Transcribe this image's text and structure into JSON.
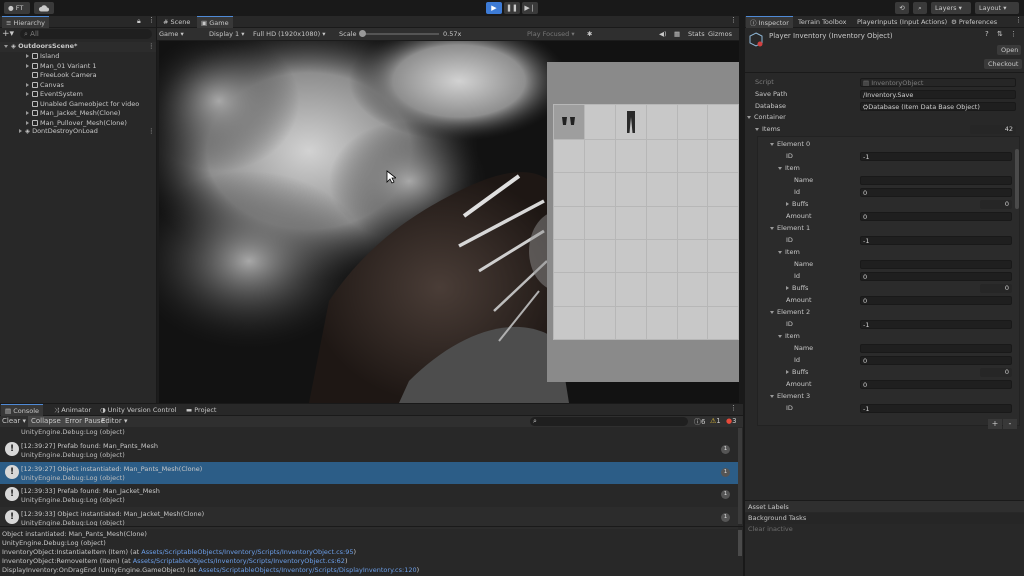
{
  "toolbar": {
    "account": "FT",
    "cloud_icon": "cloud-icon",
    "layers": "Layers",
    "layout": "Layout",
    "play_accent": "#3d7bd6"
  },
  "hierarchy": {
    "tab": "Hierarchy",
    "search_placeholder": "All",
    "scene": "OutdoorsScene*",
    "items": [
      "Island",
      "Man_01 Variant 1",
      "FreeLook Camera",
      "Canvas",
      "EventSystem",
      "Unabled Gameobject for video",
      "Man_Jacket_Mesh(Clone)",
      "Man_Pullover_Mesh(Clone)"
    ],
    "dont_destroy": "DontDestroyOnLoad"
  },
  "game_view": {
    "tabs": [
      "Scene",
      "Game"
    ],
    "mode": "Game",
    "display": "Display 1",
    "resolution": "Full HD (1920x1080)",
    "scale_label": "Scale",
    "scale_value": "0.57x",
    "play_focused": "Play Focused",
    "stats": "Stats",
    "gizmos": "Gizmos"
  },
  "inspector": {
    "tabs": [
      "Inspector",
      "Terrain Toolbox",
      "PlayerInputs (Input Actions)",
      "Preferences"
    ],
    "title": "Player Inventory (Inventory Object)",
    "open": "Open",
    "checkout": "Checkout",
    "script_label": "Script",
    "script_value": "InventoryObject",
    "save_path_label": "Save Path",
    "save_path_value": "/Inventory.Save",
    "database_label": "Database",
    "database_value": "Database (Item Data Base Object)",
    "container_label": "Container",
    "items_label": "Items",
    "items_count": "42",
    "elements": [
      {
        "name": "Element 0",
        "id": "-1",
        "item_id": "0",
        "buffs": "0",
        "amount": "0"
      },
      {
        "name": "Element 1",
        "id": "-1",
        "item_id": "0",
        "buffs": "0",
        "amount": "0"
      },
      {
        "name": "Element 2",
        "id": "-1",
        "item_id": "0",
        "buffs": "0",
        "amount": "0"
      },
      {
        "name": "Element 3",
        "id": "-1"
      }
    ],
    "field_labels": {
      "id": "ID",
      "item": "Item",
      "name": "Name",
      "id2": "Id",
      "buffs": "Buffs",
      "amount": "Amount"
    },
    "asset_labels": "Asset Labels",
    "background_tasks": "Background Tasks",
    "clear_inactive": "Clear inactive"
  },
  "console": {
    "tabs": [
      "Console",
      "Animator",
      "Unity Version Control",
      "Project"
    ],
    "clear": "Clear",
    "collapse": "Collapse",
    "error_pause": "Error Pause",
    "editor": "Editor",
    "count_info": "6",
    "count_warn": "1",
    "count_error": "3",
    "top_partial": "UnityEngine.Debug:Log (object)",
    "messages": [
      {
        "line1": "[12:39:27] Prefab found: Man_Pants_Mesh",
        "line2": "UnityEngine.Debug:Log (object)",
        "count": "1",
        "selected": false
      },
      {
        "line1": "[12:39:27] Object instantiated: Man_Pants_Mesh(Clone)",
        "line2": "UnityEngine.Debug:Log (object)",
        "count": "1",
        "selected": true
      },
      {
        "line1": "[12:39:33] Prefab found: Man_Jacket_Mesh",
        "line2": "UnityEngine.Debug:Log (object)",
        "count": "1",
        "selected": false
      },
      {
        "line1": "[12:39:33] Object instantiated: Man_Jacket_Mesh(Clone)",
        "line2": "UnityEngine.Debug:Log (object)",
        "count": "1",
        "selected": false
      }
    ],
    "detail": {
      "l1": "Object instantiated: Man_Pants_Mesh(Clone)",
      "l2": "UnityEngine.Debug:Log (object)",
      "l3_pre": "InventoryObject:InstantiateItem (Item) (at ",
      "l3_link": "Assets/ScriptableObjects/Inventory/Scripts/InventoryObject.cs:95",
      "l3_post": ")",
      "l4_pre": "InventoryObject:RemoveItem (Item) (at ",
      "l4_link": "Assets/ScriptableObjects/Inventory/Scripts/InventoryObject.cs:62",
      "l4_post": ")",
      "l5_pre": "DisplayInventory:OnDragEnd (UnityEngine.GameObject) (at ",
      "l5_link": "Assets/ScriptableObjects/Inventory/Scripts/DisplayInventory.cs:120",
      "l5_post": ")"
    },
    "selected_color": "#2c5d87"
  }
}
